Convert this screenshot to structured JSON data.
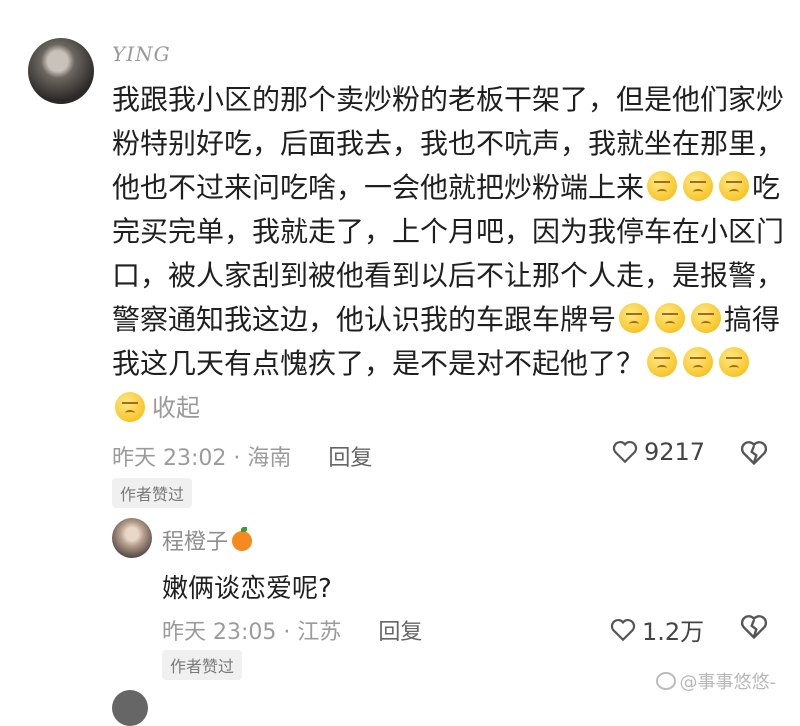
{
  "comment": {
    "username": "YING",
    "lines": [
      {
        "text": "我跟我小区的那个卖炒粉的老板干架了，但是他们家炒"
      },
      {
        "text": "粉特别好吃，后面我去，我也不吭声，我就坐在那里，"
      },
      {
        "text": "他也不过来问吃啥，一会他就把炒粉端上来",
        "emojis": 3,
        "after": "吃"
      },
      {
        "text": "完买完单，我就走了，上个月吧，因为我停车在小区门"
      },
      {
        "text": "口，被人家刮到被他看到以后不让那个人走，是报警，"
      },
      {
        "text": "警察通知我这边，他认识我的车跟车牌号",
        "emojis": 3,
        "after": "搞得"
      },
      {
        "text": "我这几天有点愧疚了，是不是对不起他了？",
        "emojis": 3,
        "after": ""
      },
      {
        "text": "",
        "emojis": 1,
        "after": "收起"
      }
    ],
    "time_location": "昨天 23:02 · 海南",
    "reply_label": "回复",
    "likes": "9217",
    "author_badge": "作者赞过"
  },
  "reply": {
    "username": "程橙子",
    "text": "嫩俩谈恋爱呢?",
    "time_location": "昨天 23:05 · 江苏",
    "reply_label": "回复",
    "likes": "1.2万",
    "author_badge": "作者赞过"
  },
  "watermark": "@事事悠悠-",
  "icons": {
    "like": "heart-outline-icon",
    "dislike": "broken-heart-icon",
    "emoji": "sad-face-emoji-icon",
    "badge": "orange-icon"
  }
}
